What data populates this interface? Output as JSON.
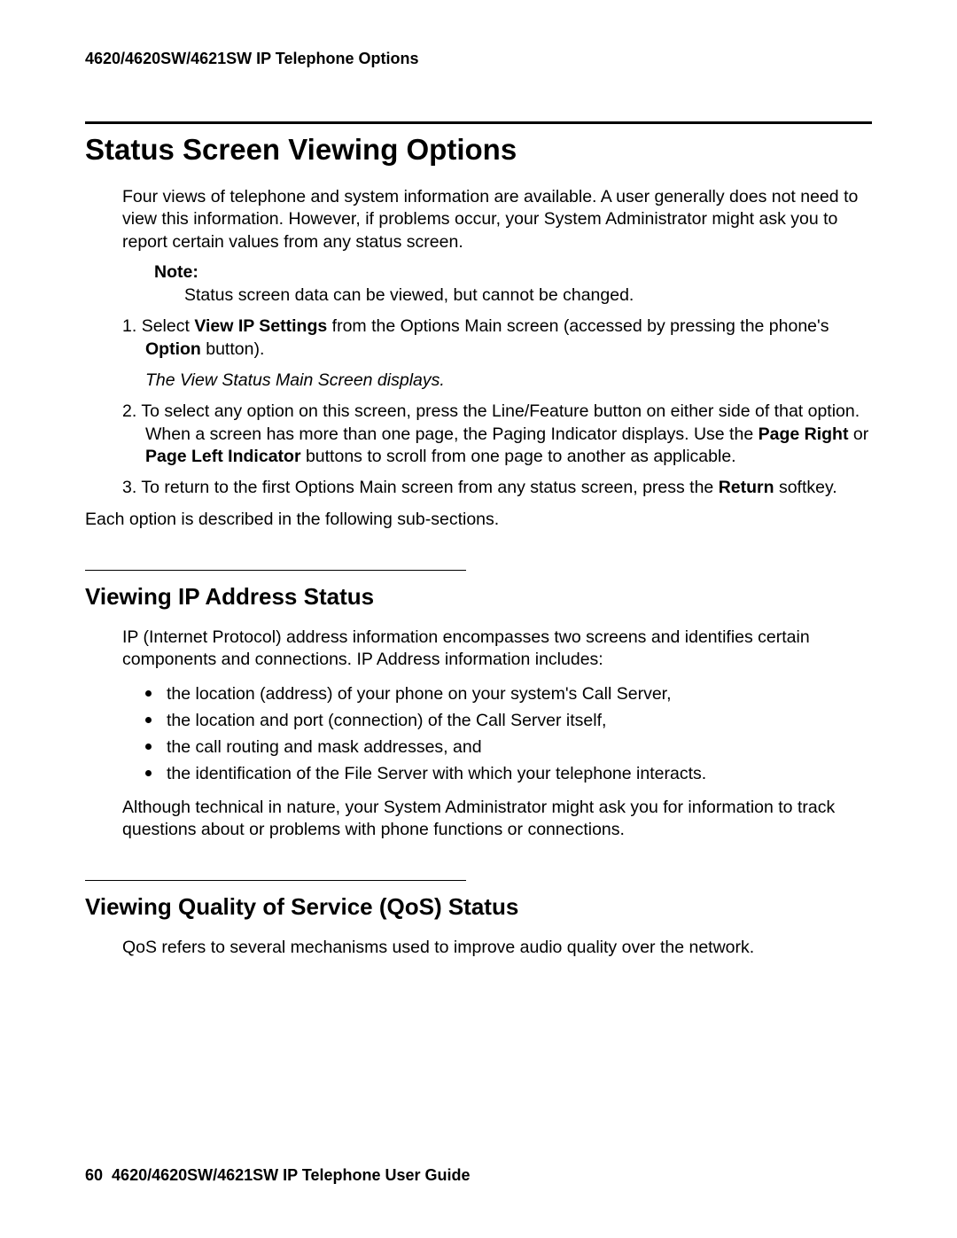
{
  "header": {
    "running_head": "4620/4620SW/4621SW IP Telephone Options"
  },
  "section1": {
    "title": "Status Screen Viewing Options",
    "intro": "Four views of telephone and system information are available. A user generally does not need to view this information. However, if problems occur, your System Administrator might ask you to report certain values from any status screen.",
    "note_label": "Note:",
    "note_text": "Status screen data can be viewed, but cannot be changed.",
    "steps": {
      "s1_num": "1. ",
      "s1_a": "Select ",
      "s1_b": "View IP Settings",
      "s1_c": " from the Options Main screen (accessed by pressing the phone's ",
      "s1_d": "Option",
      "s1_e": " button).",
      "s1_result": "The View Status Main Screen displays.",
      "s2_num": "2. ",
      "s2_a": "To select any option on this screen, press the Line/Feature button on either side of that option. When a screen has more than one page, the Paging Indicator displays. Use the ",
      "s2_b": "Page Right",
      "s2_c": " or ",
      "s2_d": "Page Left Indicator",
      "s2_e": " buttons to scroll from one page to another as applicable.",
      "s3_num": "3. ",
      "s3_a": "To return to the first Options Main screen from any status screen, press the ",
      "s3_b": "Return",
      "s3_c": " softkey."
    },
    "closing": "Each option is described in the following sub-sections."
  },
  "section2": {
    "title": "Viewing IP Address Status",
    "intro": "IP (Internet Protocol) address information encompasses two screens and identifies certain components and connections. IP Address information includes:",
    "bullets": [
      "the location (address) of your phone on your system's Call Server,",
      "the location and port (connection) of the Call Server itself,",
      "the call routing and mask addresses, and",
      "the identification of the File Server with which your telephone interacts."
    ],
    "closing": "Although technical in nature, your System Administrator might ask you for information to track questions about or problems with phone functions or connections."
  },
  "section3": {
    "title": "Viewing Quality of Service (QoS) Status",
    "intro": "QoS refers to several mechanisms used to improve audio quality over the network."
  },
  "footer": {
    "page_num": "60",
    "title": "4620/4620SW/4621SW IP Telephone User Guide"
  }
}
